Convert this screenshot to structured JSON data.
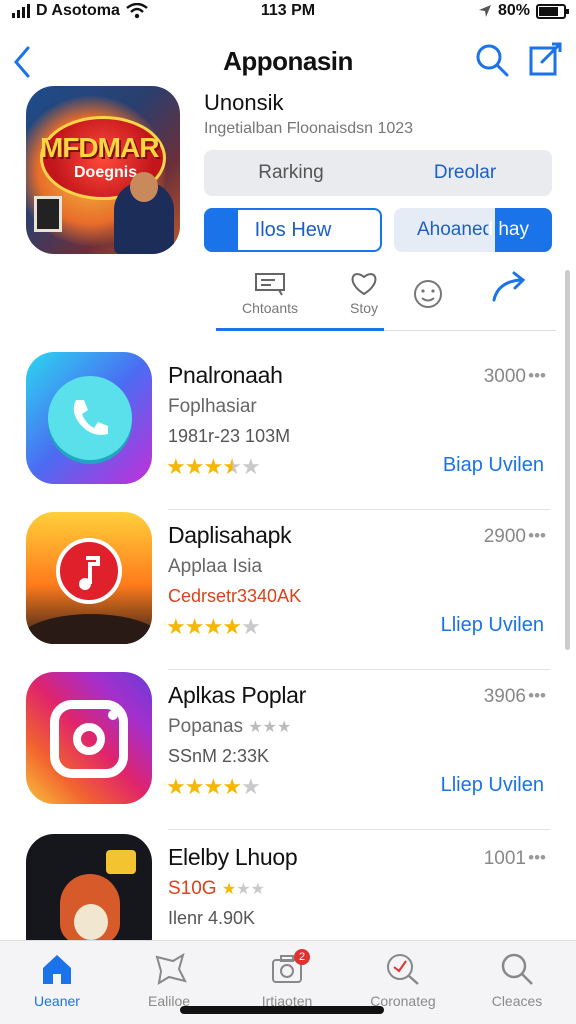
{
  "status": {
    "carrier": "D Asotoma",
    "time": "113 PM",
    "battery": "80%",
    "battery_level": 0.8
  },
  "nav": {
    "title": "Apponasin"
  },
  "hero": {
    "art_title": "MFDMAR",
    "art_subtitle": "Doegnis",
    "subtitle": "Unonsik",
    "description": "Ingetialban Floonaisdsn 1023",
    "segments": [
      "Rarking",
      "Dreolar"
    ],
    "btn_outline": "Ilos Hew",
    "btn_fill": "Ahoaned hay"
  },
  "tabs": [
    {
      "label": "Chtoants",
      "icon": "chat-box-icon"
    },
    {
      "label": "Stoy",
      "icon": "heart-icon"
    },
    {
      "label": "",
      "icon": "smile-icon"
    },
    {
      "label": "",
      "icon": "share-icon"
    }
  ],
  "apps": [
    {
      "name": "Pnalronaah",
      "category": "Foplhasiar",
      "meta": "1981r-23 103M",
      "price": "3000",
      "rating": 3.5,
      "action": "Biap Uvilen",
      "accent": "#4b6cf2"
    },
    {
      "name": "Daplisahapk",
      "category": "Applaa Isia",
      "meta": "Cedrsetr3340AK",
      "price": "2900",
      "rating": 4,
      "action": "Lliep Uvilen",
      "accent": "#ff7b1c"
    },
    {
      "name": "Aplkas Poplar",
      "category": "Popanas",
      "meta": "SSnM 2:33K",
      "price": "3906",
      "rating": 4,
      "action": "Lliep Uvilen",
      "accent": "#e0246a"
    },
    {
      "name": "Elelby Lhuop",
      "category": "S10G",
      "meta": "Ilenr 4.90K",
      "price": "1001",
      "rating": 1,
      "action": "",
      "accent": "#d65a2a"
    }
  ],
  "bottom_tabs": [
    {
      "label": "Ueaner",
      "icon": "home-icon",
      "active": true
    },
    {
      "label": "Ealiloe",
      "icon": "star-shape-icon",
      "active": false
    },
    {
      "label": "Irtiaoten",
      "icon": "camera-icon",
      "active": false,
      "badge": "2"
    },
    {
      "label": "Coronateg",
      "icon": "search-globe-icon",
      "active": false
    },
    {
      "label": "Cleaces",
      "icon": "search-icon",
      "active": false
    }
  ],
  "colors": {
    "accent": "#1a73e8",
    "star": "#f5b800"
  }
}
